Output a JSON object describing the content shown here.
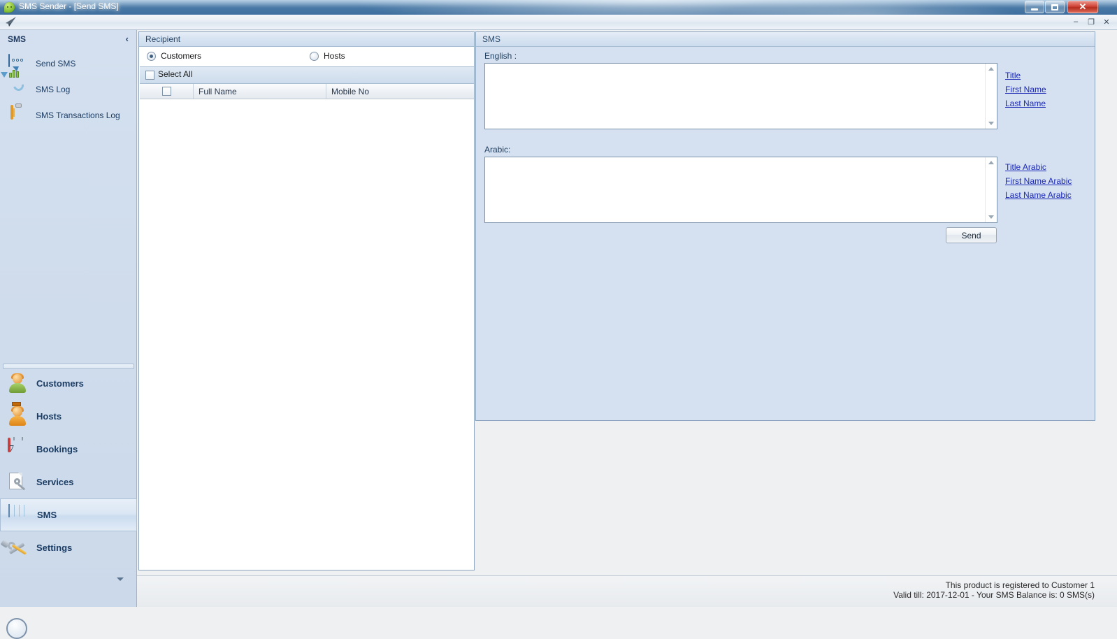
{
  "window": {
    "title": "SMS Sender - [Send SMS]",
    "app_icon": "sms-chat-icon",
    "minimize": "–",
    "maximize": "□",
    "close": "✕"
  },
  "toolbar": {
    "send_icon": "paper-plane-icon",
    "mdi_minimize": "–",
    "mdi_restore": "❐",
    "mdi_close": "✕"
  },
  "sidebar": {
    "title": "SMS",
    "collapse_glyph": "‹",
    "top_items": [
      {
        "label": "Send SMS",
        "icon": "speech-bubble-icon"
      },
      {
        "label": "SMS Log",
        "icon": "bar-chart-arrow-icon"
      },
      {
        "label": "SMS Transactions Log",
        "icon": "clipboard-icon"
      }
    ],
    "main_items": [
      {
        "label": "Customers",
        "icon": "customer-person-icon",
        "active": false
      },
      {
        "label": "Hosts",
        "icon": "host-person-icon",
        "active": false
      },
      {
        "label": "Bookings",
        "icon": "calendar-icon",
        "day": "7",
        "active": false
      },
      {
        "label": "Services",
        "icon": "document-wrench-icon",
        "active": false
      },
      {
        "label": "SMS",
        "icon": "grid-table-icon",
        "active": true
      },
      {
        "label": "Settings",
        "icon": "wrench-hammer-icon",
        "active": false
      }
    ],
    "more_glyph": "▾"
  },
  "recipient": {
    "group_title": "Recipient",
    "radio_customers": "Customers",
    "radio_hosts": "Hosts",
    "radio_selected": "Customers",
    "select_all": "Select All",
    "select_all_checked": false,
    "columns": [
      "",
      "Full Name",
      "Mobile No"
    ],
    "rows": []
  },
  "sms": {
    "group_title": "SMS",
    "english_label": "English :",
    "english_value": "",
    "arabic_label": "Arabic:",
    "arabic_value": "",
    "english_links": [
      "Title",
      "First Name",
      "Last Name"
    ],
    "arabic_links": [
      "Title Arabic",
      "First Name Arabic",
      "Last Name Arabic"
    ],
    "send_label": "Send"
  },
  "status": {
    "line1": "This product is registered to Customer 1",
    "line2": "Valid till: 2017-12-01 - Your SMS Balance is: 0 SMS(s)"
  },
  "colors": {
    "titlebar_blue": "#4b7ba8",
    "close_red": "#cf4335",
    "sidebar_blue": "#cfdcec",
    "panel_blue": "#d5e1f0",
    "link_blue": "#1c2ab5",
    "workspace_gray": "#eef0f2"
  }
}
